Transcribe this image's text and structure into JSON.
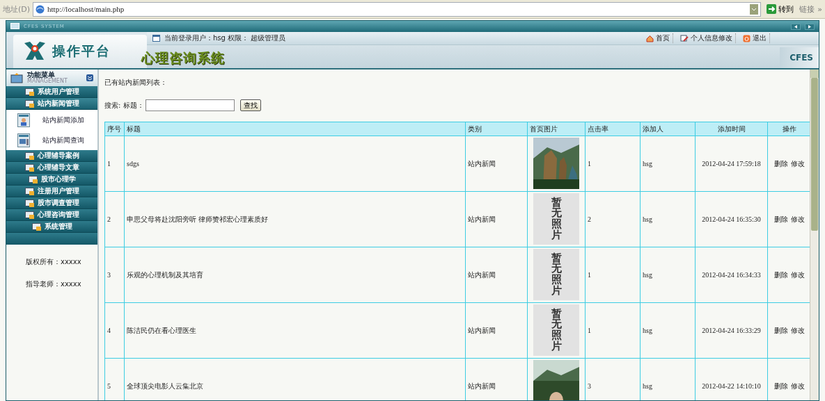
{
  "address_bar": {
    "label": "地址(D)",
    "url": "http://localhost/main.php",
    "go": "转到",
    "links": "链接",
    "more": "»"
  },
  "window": {
    "title": "CFES SYSTEM"
  },
  "header": {
    "logo_text": "操作平台",
    "system_title": "心理咨询系统",
    "user_info": "当前登录用户：hsg 权限： 超级管理员",
    "brand": "CFES",
    "links": [
      {
        "kind": "home",
        "label": "首页"
      },
      {
        "kind": "profile",
        "label": "个人信息修改"
      },
      {
        "kind": "logout",
        "label": "退出"
      }
    ]
  },
  "sidebar": {
    "title": "功能菜单",
    "subtitle": "MANAGEMENT",
    "items": [
      {
        "label": "系统用户管理",
        "expanded": false
      },
      {
        "label": "站内新闻管理",
        "expanded": true,
        "children": [
          {
            "kind": "add",
            "label": "站内新闻添加"
          },
          {
            "kind": "query",
            "label": "站内新闻查询"
          }
        ]
      },
      {
        "label": "心理辅导案例",
        "expanded": false
      },
      {
        "label": "心理辅导文章",
        "expanded": false
      },
      {
        "label": "股市心理学",
        "expanded": false
      },
      {
        "label": "注册用户管理",
        "expanded": false
      },
      {
        "label": "股市调查管理",
        "expanded": false
      },
      {
        "label": "心理咨询管理",
        "expanded": false
      },
      {
        "label": "系统管理",
        "expanded": false
      }
    ],
    "footer": [
      "版权所有：xxxxx",
      "指导老师：xxxxx"
    ]
  },
  "content": {
    "heading": "已有站内新闻列表：",
    "search": {
      "label": "搜索: 标题：",
      "button": "查找"
    },
    "table": {
      "columns": [
        "序号",
        "标题",
        "类别",
        "首页图片",
        "点击率",
        "添加人",
        "添加时间",
        "操作"
      ],
      "rows": [
        {
          "no": "1",
          "title": "sdgs",
          "category": "站内新闻",
          "image": {
            "kind": "picture"
          },
          "clicks": "1",
          "author": "hsg",
          "time": "2012-04-24 17:59:18",
          "actions": [
            "删除",
            "修改"
          ]
        },
        {
          "no": "2",
          "title": "申思父母将赴沈阳旁听 律师赞祁宏心理素质好",
          "category": "站内新闻",
          "image": {
            "kind": "placeholder",
            "text": "暂无照片"
          },
          "clicks": "2",
          "author": "hsg",
          "time": "2012-04-24 16:35:30",
          "actions": [
            "删除",
            "修改"
          ]
        },
        {
          "no": "3",
          "title": "乐观的心理机制及其培育",
          "category": "站内新闻",
          "image": {
            "kind": "placeholder",
            "text": "暂无照片"
          },
          "clicks": "1",
          "author": "hsg",
          "time": "2012-04-24 16:34:33",
          "actions": [
            "删除",
            "修改"
          ]
        },
        {
          "no": "4",
          "title": "陈洁民仍在看心理医生",
          "category": "站内新闻",
          "image": {
            "kind": "placeholder",
            "text": "暂无照片"
          },
          "clicks": "1",
          "author": "hsg",
          "time": "2012-04-24 16:33:29",
          "actions": [
            "删除",
            "修改"
          ]
        },
        {
          "no": "5",
          "title": "全球顶尖电影人云集北京",
          "category": "站内新闻",
          "image": {
            "kind": "picture"
          },
          "clicks": "3",
          "author": "hsg",
          "time": "2012-04-22 14:10:10",
          "actions": [
            "删除",
            "修改"
          ]
        }
      ]
    }
  }
}
